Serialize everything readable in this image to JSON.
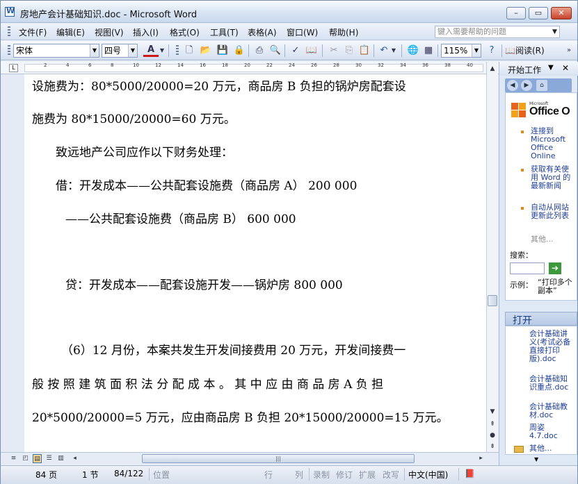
{
  "window": {
    "title": "房地产会计基础知识.doc - Microsoft Word",
    "minimize_icon": "minimize-icon",
    "maximize_icon": "maximize-icon",
    "close_icon": "close-icon"
  },
  "menu": {
    "items": [
      "文件(F)",
      "编辑(E)",
      "视图(V)",
      "插入(I)",
      "格式(O)",
      "工具(T)",
      "表格(A)",
      "窗口(W)",
      "帮助(H)"
    ],
    "help_placeholder": "键入需要帮助的问题"
  },
  "toolbar": {
    "font_name": "宋体",
    "font_size": "四号",
    "font_color_label": "A",
    "zoom": "115%",
    "read_label": "阅读(R)"
  },
  "ruler": {
    "ticks": [
      "2",
      "4",
      "6",
      "8",
      "10",
      "12",
      "14",
      "16",
      "18",
      "20",
      "22",
      "24",
      "26",
      "28",
      "30",
      "32",
      "34",
      "36",
      "38",
      "40"
    ]
  },
  "document": {
    "lines": [
      "设施费为：80*5000/20000=20 万元，商品房 B 负担的锅炉房配套设",
      "施费为 80*15000/20000=60 万元。",
      "致远地产公司应作以下财务处理：",
      "借：开发成本——公共配套设施费（商品房 A）  200 000",
      "——公共配套设施费（商品房 B）  600 000",
      "贷：开发成本——配套设施开发——锅炉房  800 000",
      "（6）12 月份，本案共发生开发间接费用 20 万元，开发间接费一",
      "般 按 照 建 筑 面 积 法 分 配 成 本 。 其 中 应 由 商 品 房   A  负 担",
      "20*5000/20000=5 万元，应由商品房 B 负担 20*15000/20000=15 万元。"
    ]
  },
  "status": {
    "page": "84 页",
    "section": "1 节",
    "page_of": "84/122",
    "position": "位置",
    "line": "行",
    "col": "列",
    "rec": "录制",
    "trk": "修订",
    "ext": "扩展",
    "ovr": "改写",
    "language": "中文(中国)"
  },
  "task_pane": {
    "title": "开始工作",
    "links": [
      "连接到 Microsoft Office Online",
      "获取有关使用 Word 的最新新闻",
      "自动从网站更新此列表"
    ],
    "more": "其他...",
    "search_label": "搜索：",
    "example_label": "示例：",
    "example_text": "“打印多个副本”",
    "open_header": "打开",
    "files": [
      "会计基础讲义(考试必备直接打印版).doc",
      "会计基础知识重点.doc",
      "会计基础教材.doc",
      "周姿 4.7.doc"
    ],
    "open_more": "其他..."
  },
  "colors": {
    "title_bar": "#dbe6f4",
    "font_color_underline": "#d01818",
    "office_logo_orange": "#e8641b",
    "link_blue": "#1f3f99"
  }
}
